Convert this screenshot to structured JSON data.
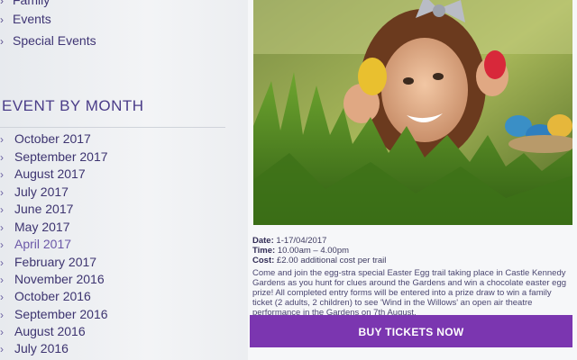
{
  "sidebar": {
    "top_links": [
      "Family",
      "Events",
      "Special Events"
    ],
    "month_heading": "EVENT BY MONTH",
    "months": [
      "October 2017",
      "September 2017",
      "August 2017",
      "July 2017",
      "June 2017",
      "May 2017",
      "April 2017",
      "February 2017",
      "November 2016",
      "October 2016",
      "September 2016",
      "August 2016",
      "July 2016"
    ],
    "active_month": "April 2017"
  },
  "event": {
    "image_alt_icon": "easter-egg-girl-photo",
    "date_label": "Date:",
    "date_value": "1-17/04/2017",
    "time_label": "Time:",
    "time_value": "10.00am – 4.00pm",
    "cost_label": "Cost:",
    "cost_value": "£2.00 additional cost per trail",
    "description": "Come and join the egg-stra special Easter Egg trail taking place in Castle Kennedy Gardens as you hunt for clues around the Gardens and win a chocolate easter egg prize! All completed entry forms will be entered into a prize draw to win a family ticket (2 adults, 2 children) to see 'Wind in the Willows' an open air theatre performance in the Gardens on 7th August.",
    "buy_button": "BUY TICKETS NOW"
  },
  "colors": {
    "accent": "#7b36b0",
    "sidebar_text": "#3f3574"
  }
}
